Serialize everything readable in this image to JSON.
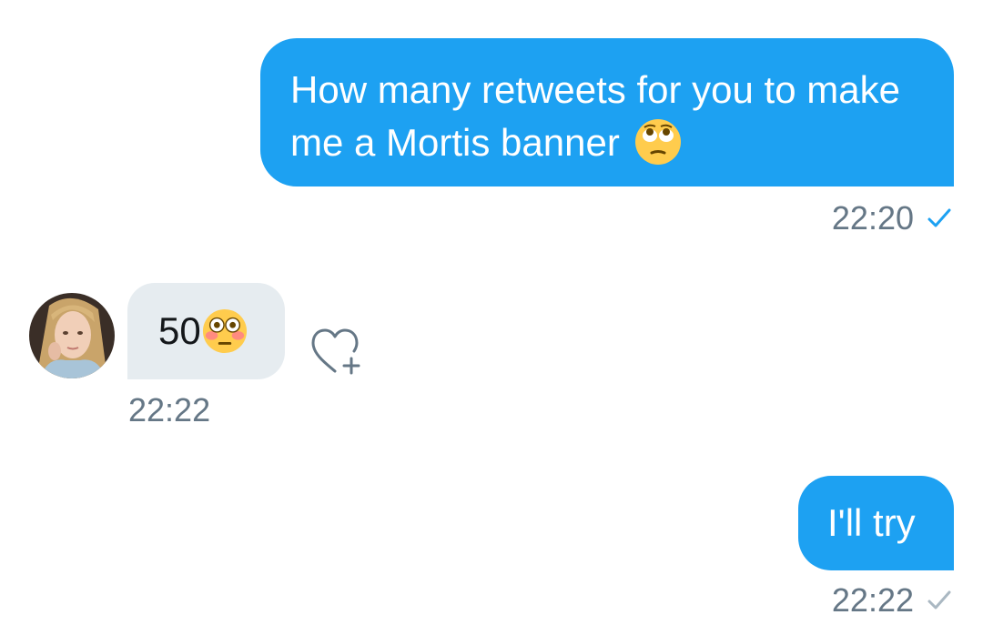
{
  "messages": [
    {
      "direction": "sent",
      "text": "How many retweets for you to make me a Mortis banner",
      "emoji": "face-with-rolling-eyes-icon",
      "time": "22:20",
      "status": "read",
      "status_color": "#1da1f2"
    },
    {
      "direction": "received",
      "text": "50",
      "emoji": "flushed-face-icon",
      "time": "22:22",
      "reaction_button": "heart-plus-icon"
    },
    {
      "direction": "sent",
      "text": "I'll try",
      "time": "22:22",
      "status": "sent",
      "status_color": "#aab8c2"
    }
  ],
  "colors": {
    "sent_bubble": "#1da1f2",
    "received_bubble": "#e6ecf0",
    "timestamp": "#657786"
  }
}
